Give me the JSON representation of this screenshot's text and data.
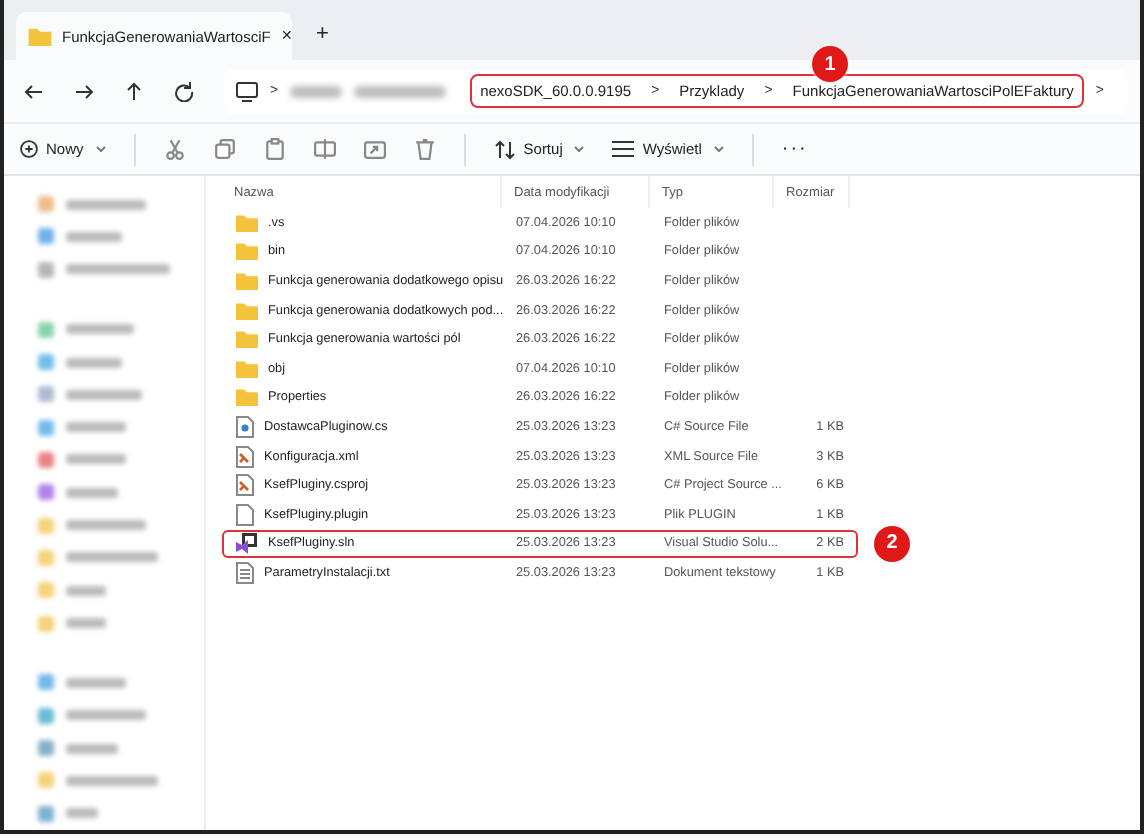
{
  "tab": {
    "title": "FunkcjaGenerowaniaWartosciF",
    "close": "✕",
    "add": "+"
  },
  "breadcrumb": {
    "separator": ">",
    "items": [
      "nexoSDK_60.0.0.9195",
      "Przyklady",
      "FunkcjaGenerowaniaWartosciPolEFaktury"
    ],
    "more": ">"
  },
  "toolbar": {
    "new": "Nowy",
    "sort": "Sortuj",
    "view": "Wyświetl",
    "more": "···"
  },
  "table": {
    "columns": [
      "Nazwa",
      "Data modyfikacji",
      "Typ",
      "Rozmiar"
    ],
    "rows": [
      {
        "kind": "folder",
        "name": ".vs",
        "date": "07.04.2026 10:10",
        "type": "Folder plików",
        "size": "",
        "highlighted": false
      },
      {
        "kind": "folder",
        "name": "bin",
        "date": "07.04.2026 10:10",
        "type": "Folder plików",
        "size": "",
        "highlighted": false
      },
      {
        "kind": "folder",
        "name": "Funkcja generowania dodatkowego opisu",
        "date": "26.03.2026 16:22",
        "type": "Folder plików",
        "size": "",
        "highlighted": false
      },
      {
        "kind": "folder",
        "name": "Funkcja generowania dodatkowych pod...",
        "date": "26.03.2026 16:22",
        "type": "Folder plików",
        "size": "",
        "highlighted": false
      },
      {
        "kind": "folder",
        "name": "Funkcja generowania wartości pól",
        "date": "26.03.2026 16:22",
        "type": "Folder plików",
        "size": "",
        "highlighted": false
      },
      {
        "kind": "folder",
        "name": "obj",
        "date": "07.04.2026 10:10",
        "type": "Folder plików",
        "size": "",
        "highlighted": false
      },
      {
        "kind": "folder",
        "name": "Properties",
        "date": "26.03.2026 16:22",
        "type": "Folder plików",
        "size": "",
        "highlighted": false
      },
      {
        "kind": "cs",
        "name": "DostawcaPluginow.cs",
        "date": "25.03.2026 13:23",
        "type": "C# Source File",
        "size": "1 KB",
        "highlighted": false
      },
      {
        "kind": "xml",
        "name": "Konfiguracja.xml",
        "date": "25.03.2026 13:23",
        "type": "XML Source File",
        "size": "3 KB",
        "highlighted": false
      },
      {
        "kind": "xml",
        "name": "KsefPluginy.csproj",
        "date": "25.03.2026 13:23",
        "type": "C# Project Source ...",
        "size": "6 KB",
        "highlighted": false
      },
      {
        "kind": "file",
        "name": "KsefPluginy.plugin",
        "date": "25.03.2026 13:23",
        "type": "Plik PLUGIN",
        "size": "1 KB",
        "highlighted": false
      },
      {
        "kind": "sln",
        "name": "KsefPluginy.sln",
        "date": "25.03.2026 13:23",
        "type": "Visual Studio Solu...",
        "size": "2 KB",
        "highlighted": true
      },
      {
        "kind": "txt",
        "name": "ParametryInstalacji.txt",
        "date": "25.03.2026 13:23",
        "type": "Dokument tekstowy",
        "size": "1 KB",
        "highlighted": false
      }
    ]
  },
  "callouts": [
    "1",
    "2"
  ]
}
